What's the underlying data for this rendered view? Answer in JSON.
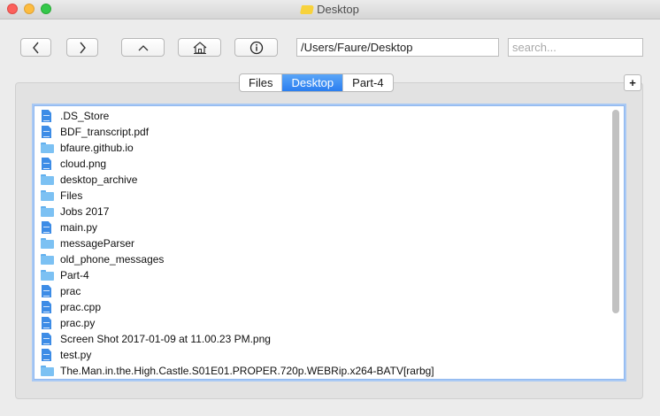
{
  "window": {
    "title": "Desktop"
  },
  "toolbar": {
    "back_icon": "chevron-left-icon",
    "forward_icon": "chevron-right-icon",
    "up_icon": "chevron-up-icon",
    "home_icon": "home-icon",
    "info_icon": "info-icon",
    "path_value": "/Users/Faure/Desktop",
    "search_value": "",
    "search_placeholder": "search..."
  },
  "tabs": [
    {
      "label": "Files",
      "active": false
    },
    {
      "label": "Desktop",
      "active": true
    },
    {
      "label": "Part-4",
      "active": false
    }
  ],
  "add_tab_label": "+",
  "files": [
    {
      "name": ".DS_Store",
      "kind": "document"
    },
    {
      "name": "BDF_transcript.pdf",
      "kind": "document"
    },
    {
      "name": "bfaure.github.io",
      "kind": "folder"
    },
    {
      "name": "cloud.png",
      "kind": "document"
    },
    {
      "name": "desktop_archive",
      "kind": "folder"
    },
    {
      "name": "Files",
      "kind": "folder"
    },
    {
      "name": "Jobs 2017",
      "kind": "folder"
    },
    {
      "name": "main.py",
      "kind": "document"
    },
    {
      "name": "messageParser",
      "kind": "folder"
    },
    {
      "name": "old_phone_messages",
      "kind": "folder"
    },
    {
      "name": "Part-4",
      "kind": "folder"
    },
    {
      "name": "prac",
      "kind": "document"
    },
    {
      "name": "prac.cpp",
      "kind": "document"
    },
    {
      "name": "prac.py",
      "kind": "document"
    },
    {
      "name": "Screen Shot 2017-01-09 at 11.00.23 PM.png",
      "kind": "document"
    },
    {
      "name": "test.py",
      "kind": "document"
    },
    {
      "name": "The.Man.in.the.High.Castle.S01E01.PROPER.720p.WEBRip.x264-BATV[rarbg]",
      "kind": "folder"
    }
  ],
  "colors": {
    "accent": "#2a7ef0",
    "folder": "#7cc1f3",
    "document": "#3d8ce6"
  }
}
